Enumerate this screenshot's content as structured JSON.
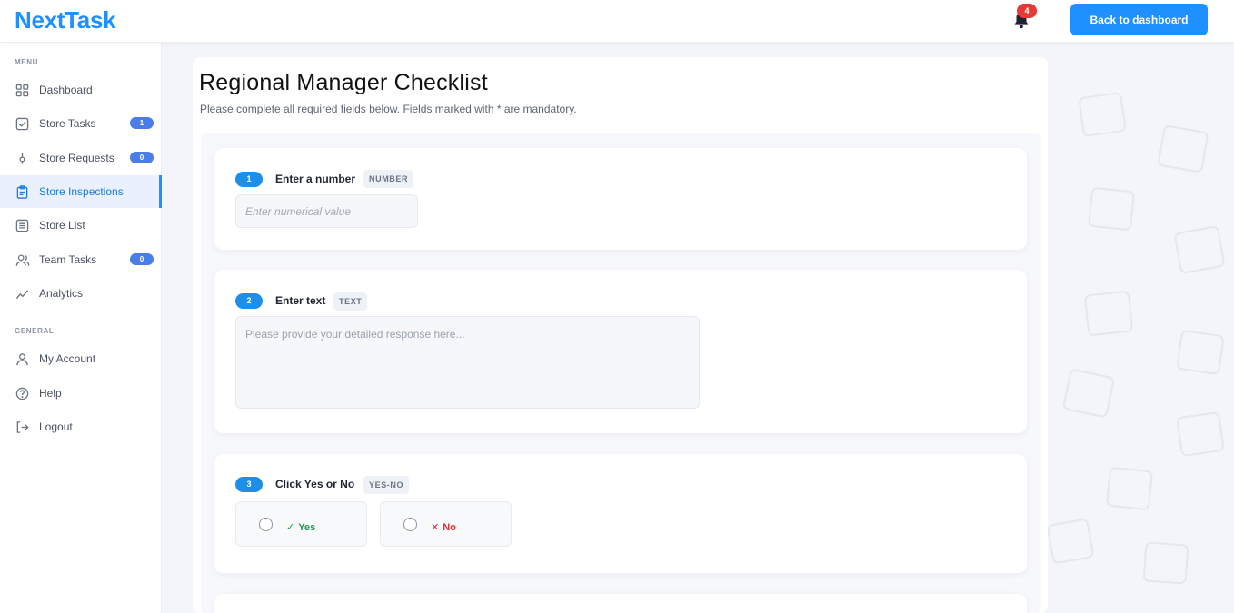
{
  "app": {
    "logo": "NextTask"
  },
  "header": {
    "notification_count": "4",
    "back_button": "Back to dashboard"
  },
  "sidebar": {
    "menu_label": "MENU",
    "general_label": "GENERAL",
    "menu_items": [
      {
        "label": "Dashboard",
        "icon": "dashboard-icon"
      },
      {
        "label": "Store Tasks",
        "icon": "checkbox-icon",
        "badge": "1"
      },
      {
        "label": "Store Requests",
        "icon": "request-icon",
        "badge": "0"
      },
      {
        "label": "Store Inspections",
        "icon": "clipboard-icon",
        "active": true
      },
      {
        "label": "Store List",
        "icon": "list-icon"
      },
      {
        "label": "Team Tasks",
        "icon": "team-icon",
        "badge": "0"
      },
      {
        "label": "Analytics",
        "icon": "chart-line-icon"
      }
    ],
    "general_items": [
      {
        "label": "My Account",
        "icon": "user-icon"
      },
      {
        "label": "Help",
        "icon": "help-icon"
      },
      {
        "label": "Logout",
        "icon": "logout-icon"
      }
    ]
  },
  "page": {
    "title": "Regional Manager Checklist",
    "subtitle": "Please complete all required fields below. Fields marked with * are mandatory."
  },
  "questions": [
    {
      "number": "1",
      "label": "Enter a number",
      "type": "NUMBER",
      "placeholder": "Enter numerical value"
    },
    {
      "number": "2",
      "label": "Enter text",
      "type": "TEXT",
      "placeholder": "Please provide your detailed response here..."
    },
    {
      "number": "3",
      "label": "Click Yes or No",
      "type": "YES-NO",
      "options": [
        {
          "mark": "✓",
          "label": "Yes",
          "color": "#1f9d55"
        },
        {
          "mark": "✕",
          "label": "No",
          "color": "#e03131"
        }
      ]
    }
  ],
  "colors": {
    "accent": "#1e90ff",
    "active_bg": "#e8f1fd",
    "badge": "#4a7de8",
    "danger": "#e53935"
  }
}
